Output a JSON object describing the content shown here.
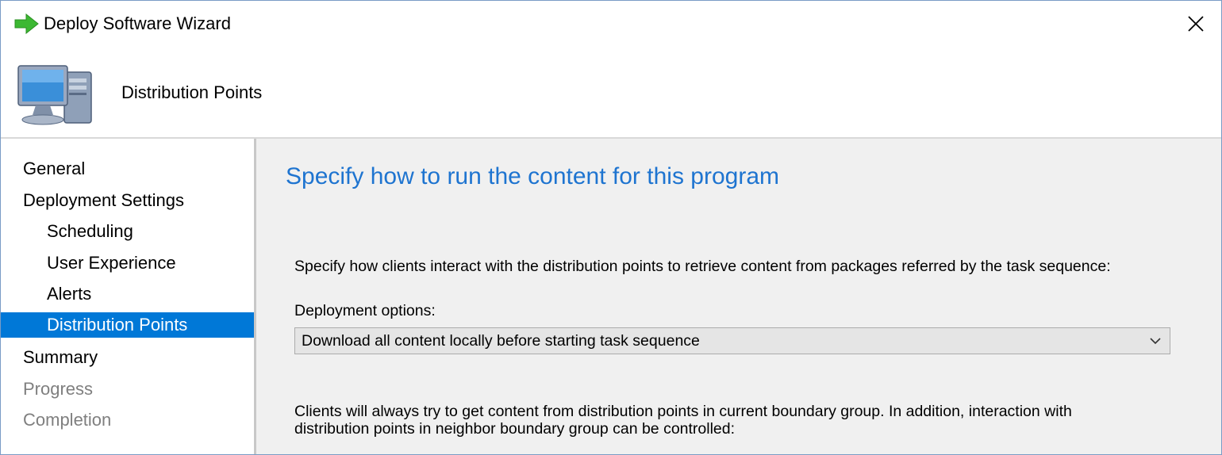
{
  "window": {
    "title": "Deploy Software Wizard",
    "close_glyph": "✕"
  },
  "header": {
    "title": "Distribution Points"
  },
  "sidebar": {
    "items": [
      {
        "label": "General",
        "level": 1,
        "state": "normal"
      },
      {
        "label": "Deployment Settings",
        "level": 1,
        "state": "normal"
      },
      {
        "label": "Scheduling",
        "level": 2,
        "state": "normal"
      },
      {
        "label": "User Experience",
        "level": 2,
        "state": "normal"
      },
      {
        "label": "Alerts",
        "level": 2,
        "state": "normal"
      },
      {
        "label": "Distribution Points",
        "level": 2,
        "state": "selected"
      },
      {
        "label": "Summary",
        "level": 1,
        "state": "normal"
      },
      {
        "label": "Progress",
        "level": 1,
        "state": "disabled"
      },
      {
        "label": "Completion",
        "level": 1,
        "state": "disabled"
      }
    ]
  },
  "main": {
    "heading": "Specify how to run the content for this program",
    "instruction": "Specify how clients interact with the distribution points to retrieve content from packages referred by the task sequence:",
    "deployment_options_label": "Deployment options:",
    "deployment_options_value": "Download all content locally before starting task sequence",
    "boundary_note": "Clients will always try to get content from distribution points in current boundary group. In addition, interaction with distribution points in neighbor boundary group can be controlled:"
  },
  "colors": {
    "accent": "#0078d7",
    "heading": "#1e74d0",
    "content_bg": "#f0f0f0",
    "disabled_text": "#7f7f7f"
  },
  "icons": {
    "title": "green-arrow-icon",
    "header": "computer-icon",
    "close": "close-icon",
    "dropdown": "chevron-down-icon"
  }
}
